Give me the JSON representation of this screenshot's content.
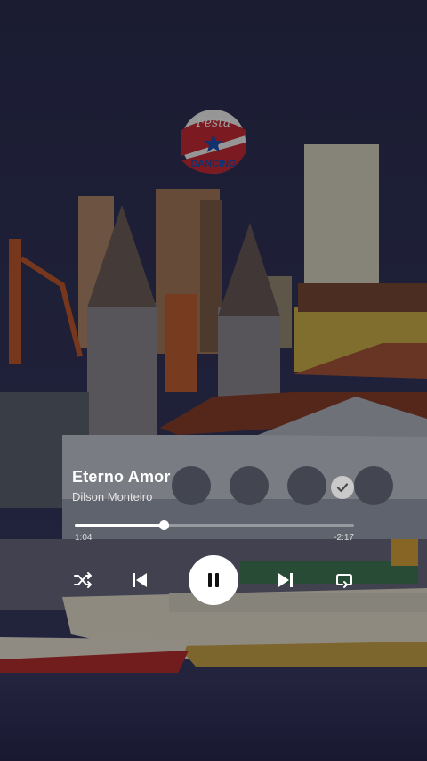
{
  "track": {
    "title": "Eterno Amor",
    "artist": "Dilson Monteiro",
    "liked": true
  },
  "progress": {
    "elapsed": "1:04",
    "remaining": "-2:17",
    "fraction": 0.32
  },
  "artwork": {
    "badge_top": "Festa",
    "badge_bottom": "DANCING"
  },
  "controls": [
    "shuffle-icon",
    "skip-previous-icon",
    "pause-icon",
    "skip-next-icon",
    "repeat-icon"
  ],
  "colors": {
    "accent": "#ffffff",
    "badge_red": "#c92b36",
    "badge_blue": "#1f4fb0",
    "liked_bg": "#c9c9c9"
  }
}
